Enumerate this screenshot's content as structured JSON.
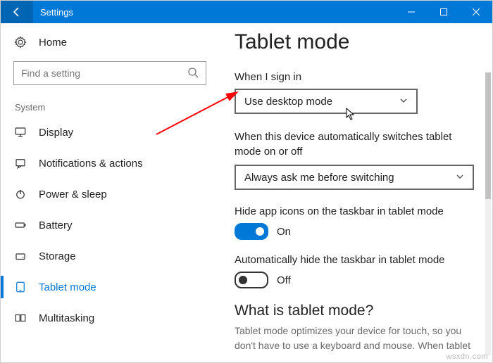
{
  "titlebar": {
    "title": "Settings"
  },
  "sidebar": {
    "home": "Home",
    "search_placeholder": "Find a setting",
    "category": "System",
    "items": [
      {
        "label": "Display"
      },
      {
        "label": "Notifications & actions"
      },
      {
        "label": "Power & sleep"
      },
      {
        "label": "Battery"
      },
      {
        "label": "Storage"
      },
      {
        "label": "Tablet mode"
      },
      {
        "label": "Multitasking"
      }
    ]
  },
  "main": {
    "title": "Tablet mode",
    "signin_label": "When I sign in",
    "signin_value": "Use desktop mode",
    "switch_label": "When this device automatically switches tablet mode on or off",
    "switch_value": "Always ask me before switching",
    "hide_icons_label": "Hide app icons on the taskbar in tablet mode",
    "hide_icons_state": "On",
    "auto_hide_label": "Automatically hide the taskbar in tablet mode",
    "auto_hide_state": "Off",
    "what_title": "What is tablet mode?",
    "what_body": "Tablet mode optimizes your device for touch, so you don't have to use a keyboard and mouse. When tablet"
  },
  "watermark": "wsxdn.com"
}
